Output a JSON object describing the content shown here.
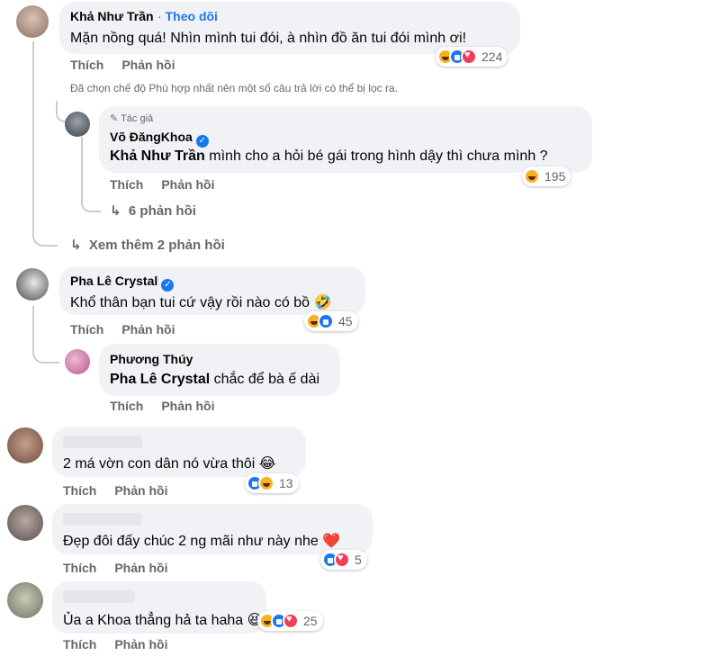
{
  "comments": [
    {
      "name": "Khả Như Trần",
      "follow": "Theo dõi",
      "text": "Mặn nồng quá! Nhìn mình tui đói, à nhìn đồ ăn tui đói mình ơi!",
      "actions": [
        "Thích",
        "Phản hồi"
      ],
      "reaction_count": "224",
      "reactions": [
        "haha",
        "like",
        "love"
      ]
    },
    {
      "author_badge": "Tác giả",
      "name": "Võ ĐăngKhoa",
      "tag": "Khả Như Trần",
      "text": " mình cho a hỏi bé gái trong hình dậy thì chưa mình ?",
      "actions": [
        "Thích",
        "Phản hồi"
      ],
      "reaction_count": "195",
      "reactions": [
        "haha"
      ]
    },
    {
      "name": "Pha Lê Crystal",
      "text": "Khổ thân bạn tui cứ vậy rồi nào có bồ 🤣",
      "actions": [
        "Thích",
        "Phản hồi"
      ],
      "reaction_count": "45",
      "reactions": [
        "haha",
        "like"
      ]
    },
    {
      "name": "Phương Thúy",
      "tag": "Pha Lê Crystal",
      "text": " chắc để bà ế dài",
      "actions": [
        "Thích",
        "Phản hồi"
      ]
    },
    {
      "text": "2 má vờn con dân nó vừa thôi 😂",
      "actions": [
        "Thích",
        "Phản hồi"
      ],
      "reaction_count": "13",
      "reactions": [
        "like",
        "haha"
      ]
    },
    {
      "text": "Đẹp đôi đấy chúc 2 ng mãi như này nhe ❤️",
      "actions": [
        "Thích",
        "Phản hồi"
      ],
      "reaction_count": "5",
      "reactions": [
        "like",
        "love"
      ]
    },
    {
      "text": "Ủa a Khoa thẳng hả ta haha 😆",
      "actions": [
        "Thích",
        "Phản hồi"
      ],
      "reaction_count": "25",
      "reactions": [
        "haha",
        "like",
        "love"
      ]
    }
  ],
  "filter_notice": "Đã chọn chế độ Phù hợp nhất nên một số câu trả lời có thể bị lọc ra.",
  "more_replies_6": "6 phản hồi",
  "more_replies_2": "Xem thêm 2 phản hồi"
}
